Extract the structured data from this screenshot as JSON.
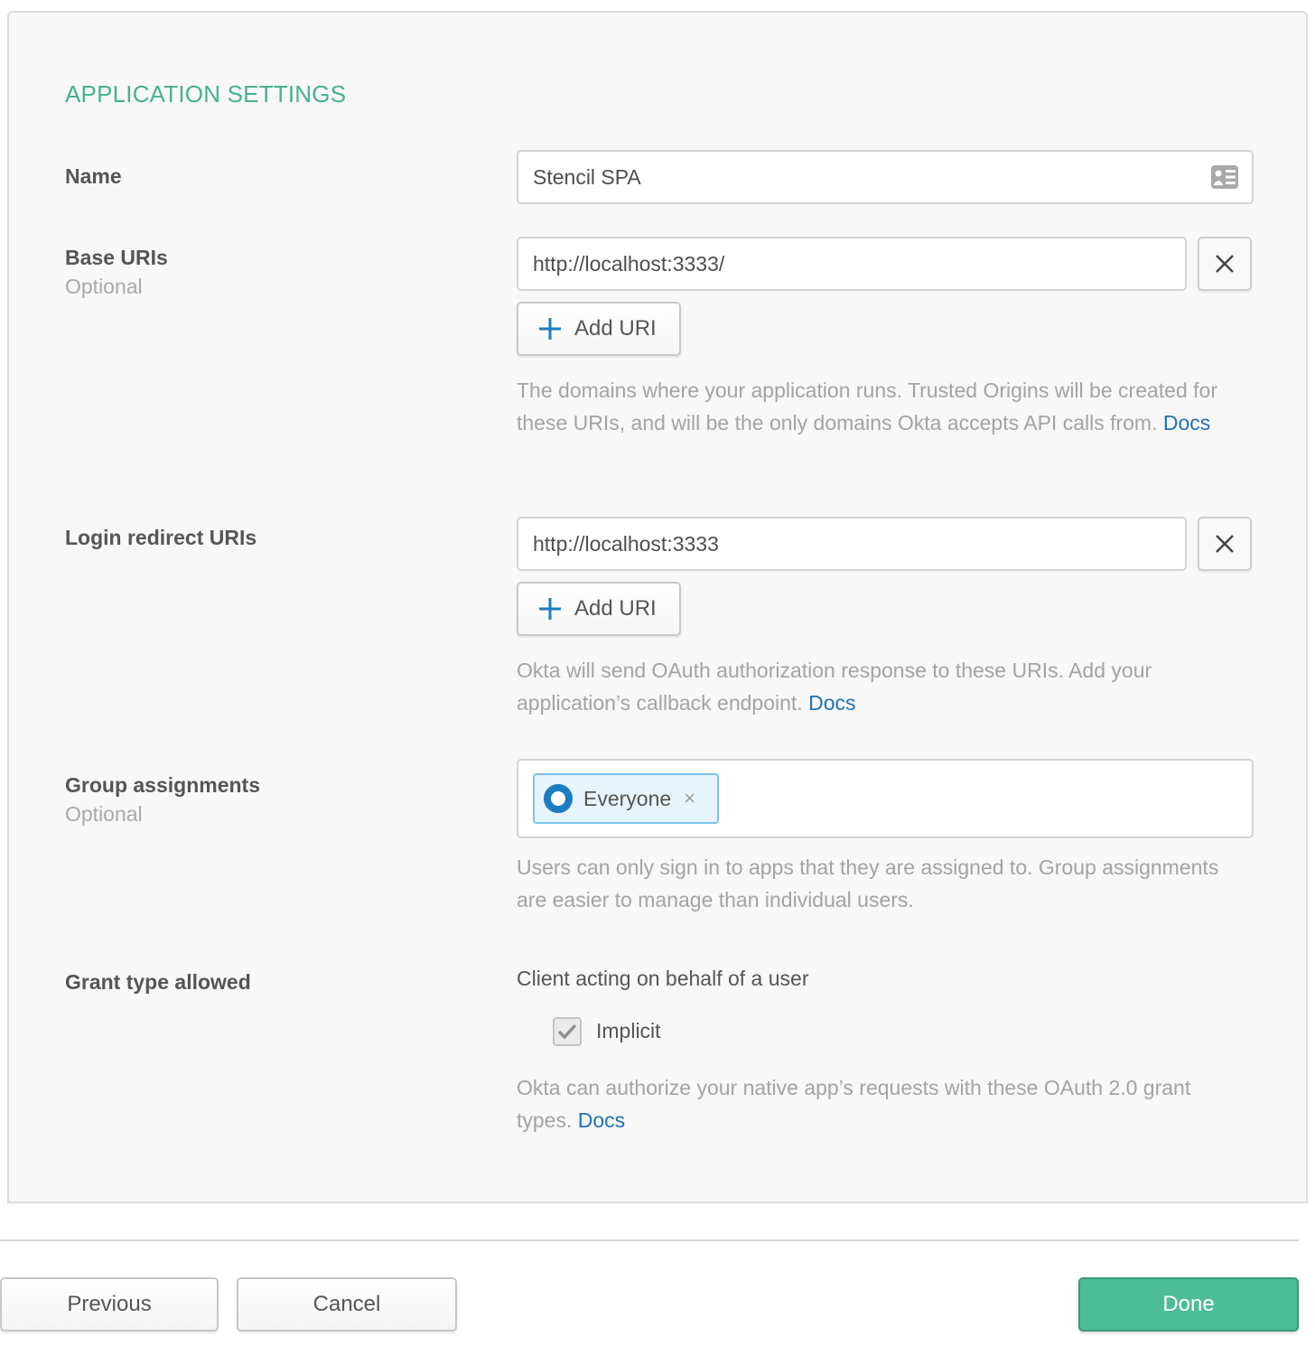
{
  "section_title": "APPLICATION SETTINGS",
  "fields": {
    "name": {
      "label": "Name",
      "value": "Stencil SPA",
      "icon": "contact-card-icon"
    },
    "base_uris": {
      "label": "Base URIs",
      "sublabel": "Optional",
      "values": [
        "http://localhost:3333/"
      ],
      "add_label": "Add URI",
      "help": "The domains where your application runs. Trusted Origins will be created for these URIs, and will be the only domains Okta accepts API calls from. ",
      "docs_label": "Docs"
    },
    "login_redirect_uris": {
      "label": "Login redirect URIs",
      "values": [
        "http://localhost:3333"
      ],
      "add_label": "Add URI",
      "help": "Okta will send OAuth authorization response to these URIs. Add your application’s callback endpoint. ",
      "docs_label": "Docs"
    },
    "group_assignments": {
      "label": "Group assignments",
      "sublabel": "Optional",
      "chips": [
        {
          "label": "Everyone",
          "remove": "×"
        }
      ],
      "help": "Users can only sign in to apps that they are assigned to. Group assignments are easier to manage than individual users."
    },
    "grant_type": {
      "label": "Grant type allowed",
      "group_title": "Client acting on behalf of a user",
      "options": [
        {
          "label": "Implicit",
          "checked": true,
          "disabled": true
        }
      ],
      "help": "Okta can authorize your native app’s requests with these OAuth 2.0 grant types. ",
      "docs_label": "Docs"
    }
  },
  "footer": {
    "previous_label": "Previous",
    "cancel_label": "Cancel",
    "done_label": "Done"
  },
  "colors": {
    "accent_green": "#46b18e",
    "primary_button": "#4dbd97",
    "link_blue": "#1f72b8",
    "chip_blue": "#1a7dc2"
  }
}
